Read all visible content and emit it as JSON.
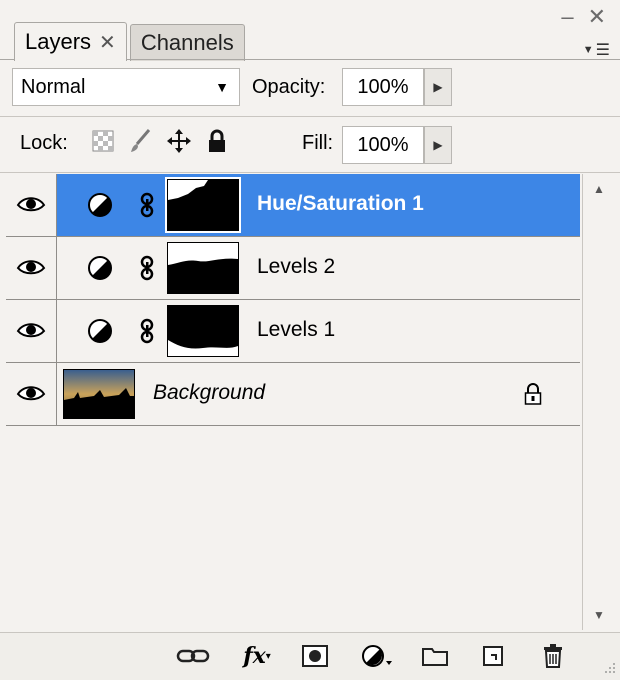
{
  "tabs": [
    {
      "label": "Layers",
      "active": true
    },
    {
      "label": "Channels",
      "active": false
    }
  ],
  "controls": {
    "blend_mode": "Normal",
    "opacity_label": "Opacity:",
    "opacity_value": "100%",
    "lock_label": "Lock:",
    "fill_label": "Fill:",
    "fill_value": "100%"
  },
  "layers": [
    {
      "name": "Hue/Saturation 1",
      "selected": true,
      "type": "adjustment"
    },
    {
      "name": "Levels 2",
      "selected": false,
      "type": "adjustment"
    },
    {
      "name": "Levels 1",
      "selected": false,
      "type": "adjustment"
    },
    {
      "name": "Background",
      "selected": false,
      "type": "background",
      "locked": true
    }
  ],
  "colors": {
    "selection": "#3d86e6",
    "panel_bg": "#f4f2ef"
  },
  "toolbar_icons": [
    "link-layers-icon",
    "fx-icon",
    "layer-mask-icon",
    "adjustment-layer-icon",
    "new-group-icon",
    "new-layer-icon",
    "delete-icon"
  ]
}
